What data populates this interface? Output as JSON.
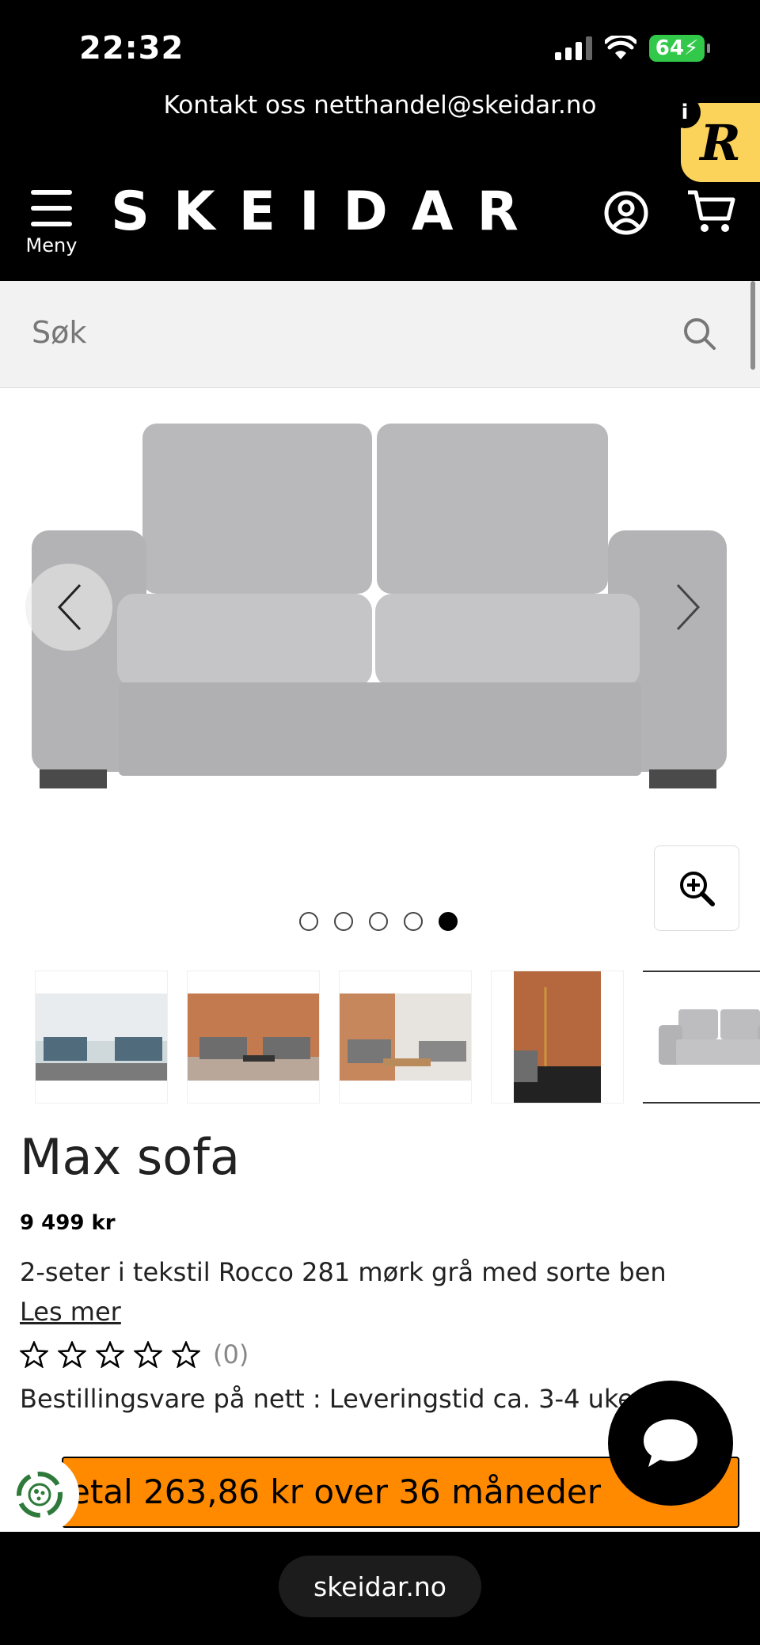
{
  "status_bar": {
    "time": "22:32",
    "battery": "64"
  },
  "header": {
    "contact_text": "Kontakt oss netthandel@skeidar.no",
    "menu_label": "Meny",
    "logo": "SKEIDAR",
    "badge_i": "i",
    "badge_r": "R"
  },
  "search": {
    "placeholder": "Søk"
  },
  "product": {
    "title": "Max sofa",
    "price": "9 499 kr",
    "description": "2-seter i tekstil Rocco 281 mørk grå med sorte ben",
    "read_more": "Les mer",
    "rating_count": "(0)",
    "delivery": "Bestillingsvare på nett : Leveringstid ca. 3-4 uker",
    "finance": "etal 263,86 kr over 36 måneder"
  },
  "gallery": {
    "slide_count": 5,
    "active_slide": 5
  },
  "browser": {
    "url": "skeidar.no"
  },
  "colors": {
    "accent": "#ff8a00",
    "badge": "#fbd25a",
    "battery": "#32c94a"
  }
}
